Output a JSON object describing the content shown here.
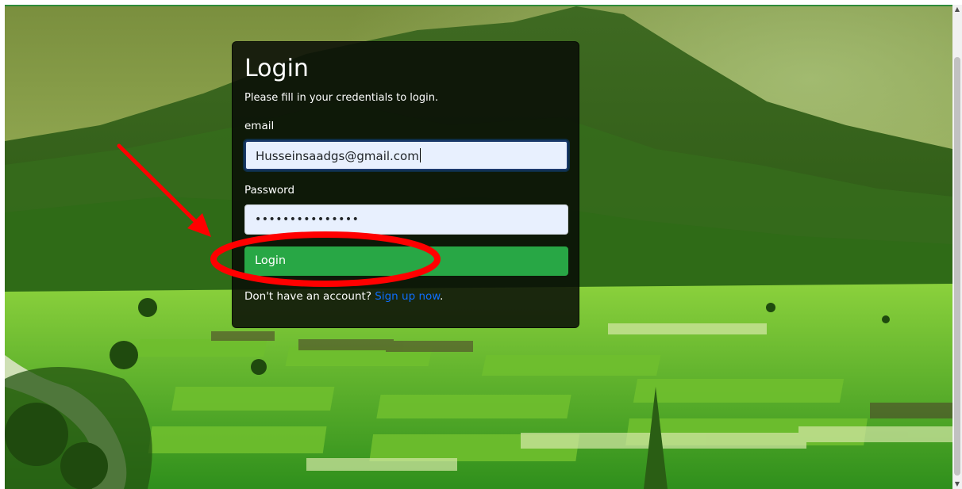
{
  "login_card": {
    "title": "Login",
    "subtitle": "Please fill in your credentials to login.",
    "email_label": "email",
    "email_value": "Husseinsaadgs@gmail.com",
    "password_label": "Password",
    "password_masked": "•••••••••••••••",
    "submit_label": "Login",
    "signup_prompt": "Don't have an account?",
    "signup_link": "Sign up now",
    "signup_suffix": "."
  },
  "scrollbar": {
    "up_icon": "scroll-up-arrow",
    "down_icon": "scroll-down-arrow"
  },
  "colors": {
    "button": "#28a745",
    "link": "#0d6efd",
    "annotation": "#ff0000",
    "input_fill": "#e8f0fe"
  }
}
